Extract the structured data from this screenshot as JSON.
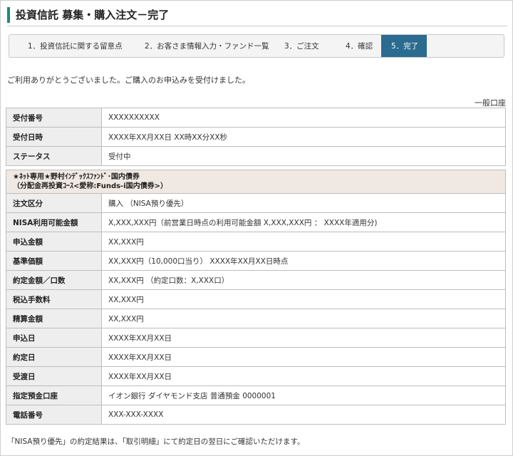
{
  "page_title": "投資信託 募集・購入注文－完了",
  "steps": [
    {
      "label": "1．投資信託に関する留意点"
    },
    {
      "label": "2．お客さま情報入力・ファンド一覧"
    },
    {
      "label": "3．ご注文"
    },
    {
      "label": "4．確認"
    },
    {
      "label": "5．完了",
      "active": true
    }
  ],
  "message": "ご利用ありがとうございました。ご購入のお申込みを受付けました。",
  "account_type": "一般口座",
  "reception": [
    {
      "label": "受付番号",
      "value": "XXXXXXXXXX"
    },
    {
      "label": "受付日時",
      "value": "XXXX年XX月XX日 XX時XX分XX秒"
    },
    {
      "label": "ステータス",
      "value": "受付中"
    }
  ],
  "fund": {
    "name_line1": "★ﾈｯﾄ専用★野村ｲﾝﾃﾞｯｸｽﾌｧﾝﾄﾞ･国内債券",
    "name_line2": "（分配金再投資ｺｰｽ<愛称:Funds-i国内債券>）"
  },
  "order": [
    {
      "label": "注文区分",
      "value": "購入 （NISA預り優先）"
    },
    {
      "label": "NISA利用可能金額",
      "value": "X,XXX,XXX円（前営業日時点の利用可能金額 X,XXX,XXX円 ： XXXX年適用分)"
    },
    {
      "label": "申込金額",
      "value": "XX,XXX円"
    },
    {
      "label": "基準価額",
      "value": "XX,XXX円（10,000口当り） XXXX年XX月XX日時点"
    },
    {
      "label": "約定金額／口数",
      "value": "XX,XXX円 （約定口数：X,XXX口）"
    },
    {
      "label": "税込手数料",
      "value": "XX,XXX円"
    },
    {
      "label": "精算金額",
      "value": "XX,XXX円"
    },
    {
      "label": "申込日",
      "value": "XXXX年XX月XX日"
    },
    {
      "label": "約定日",
      "value": "XXXX年XX月XX日"
    },
    {
      "label": "受渡日",
      "value": "XXXX年XX月XX日"
    },
    {
      "label": "指定預金口座",
      "value": "イオン銀行 ダイヤモンド支店 普通預金 0000001"
    },
    {
      "label": "電話番号",
      "value": "XXX-XXX-XXXX"
    }
  ],
  "footer_note": "「NISA預り優先」の約定結果は、「取引明細」にて約定日の翌日にご確認いただけます。"
}
